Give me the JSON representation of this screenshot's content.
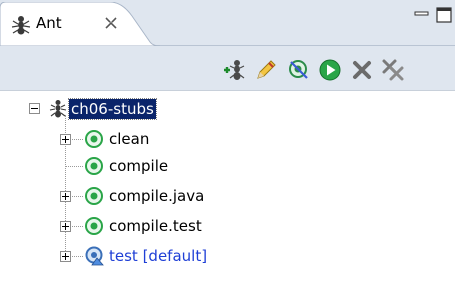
{
  "view": {
    "tab_label": "Ant",
    "tab_icon": "ant-icon",
    "close_icon": "close-icon",
    "minimize_icon": "minimize-icon",
    "maximize_icon": "maximize-icon"
  },
  "toolbar": {
    "buttons": [
      {
        "icon": "add-buildfile-icon"
      },
      {
        "icon": "search-buildfile-icon"
      },
      {
        "icon": "hide-internal-targets-icon"
      },
      {
        "icon": "run-icon"
      },
      {
        "icon": "remove-icon"
      },
      {
        "icon": "remove-all-icon"
      }
    ]
  },
  "tree": {
    "root": {
      "label": "ch06-stubs",
      "icon": "ant-icon",
      "expanded": true
    },
    "targets": [
      {
        "label": "clean",
        "icon": "target-icon",
        "expandable": true
      },
      {
        "label": "compile",
        "icon": "target-icon",
        "expandable": false
      },
      {
        "label": "compile.java",
        "icon": "target-icon",
        "expandable": true
      },
      {
        "label": "compile.test",
        "icon": "target-icon",
        "expandable": true
      },
      {
        "label": "test [default]",
        "icon": "default-target-icon",
        "expandable": true,
        "is_default": true
      }
    ]
  },
  "colors": {
    "selection_bg": "#0a246a",
    "default_target_text": "#1f3fd6",
    "target_green": "#2aa548",
    "panel_bg": "#dfe6ef"
  }
}
